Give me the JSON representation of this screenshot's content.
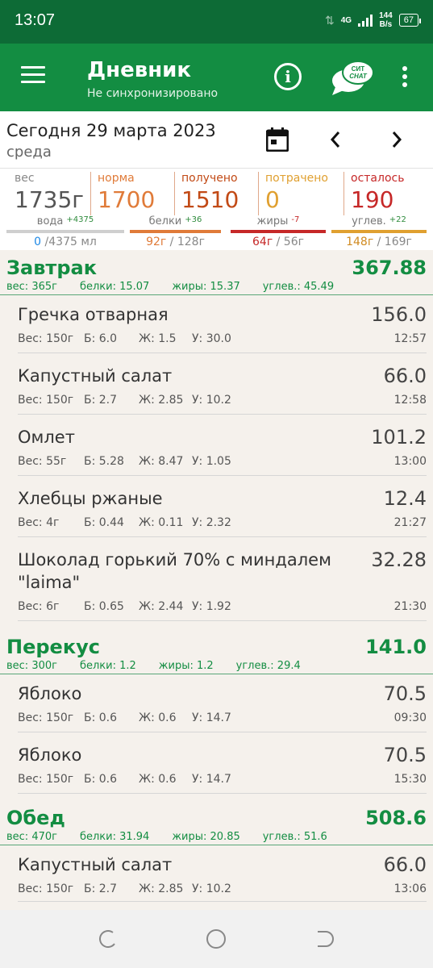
{
  "status": {
    "time": "13:07",
    "net": "4G",
    "speed_top": "144",
    "speed_bottom": "B/s",
    "battery": "67"
  },
  "header": {
    "title": "Дневник",
    "subtitle": "Не синхронизировано",
    "chat_badge_top": "СИТ",
    "chat_badge_bottom": "CHAT"
  },
  "date": {
    "label": "Сегодня 29 марта 2023",
    "weekday": "среда"
  },
  "summary": {
    "weight": {
      "label": "вес",
      "value": "1735г"
    },
    "norm": {
      "label": "норма",
      "value": "1700"
    },
    "received": {
      "label": "получено",
      "value": "1510"
    },
    "spent": {
      "label": "потрачено",
      "value": "0"
    },
    "left": {
      "label": "осталось",
      "value": "190"
    },
    "water": {
      "label": "вода",
      "delta": "+4375",
      "value": "0",
      "max": "/4375 мл"
    },
    "protein": {
      "label": "белки",
      "delta": "+36",
      "value": "92г",
      "max": " / 128г"
    },
    "fat": {
      "label": "жиры",
      "delta": "-7",
      "value": "64г",
      "max": " / 56г"
    },
    "carbs": {
      "label": "углев.",
      "delta": "+22",
      "value": "148г",
      "max": " / 169г"
    }
  },
  "colors": {
    "green": "#138d42",
    "orange": "#e07b39",
    "red": "#c62828",
    "gold": "#e0a030"
  },
  "sections": [
    {
      "name": "Завтрак",
      "total": "367.88",
      "macros": [
        "вес: 365г",
        "белки: 15.07",
        "жиры: 15.37",
        "углев.: 45.49"
      ],
      "items": [
        {
          "name": "Гречка отварная",
          "kcal": "156.0",
          "w": "Вес: 150г",
          "b": "Б: 6.0",
          "z": "Ж: 1.5",
          "u": "У: 30.0",
          "time": "12:57"
        },
        {
          "name": "Капустный салат",
          "kcal": "66.0",
          "w": "Вес: 150г",
          "b": "Б: 2.7",
          "z": "Ж: 2.85",
          "u": "У: 10.2",
          "time": "12:58"
        },
        {
          "name": "Омлет",
          "kcal": "101.2",
          "w": "Вес: 55г",
          "b": "Б: 5.28",
          "z": "Ж: 8.47",
          "u": "У: 1.05",
          "time": "13:00"
        },
        {
          "name": "Хлебцы ржаные",
          "kcal": "12.4",
          "w": "Вес: 4г",
          "b": "Б: 0.44",
          "z": "Ж: 0.11",
          "u": "У: 2.32",
          "time": "21:27"
        },
        {
          "name": "Шоколад горький 70% с миндалем \"laima\"",
          "kcal": "32.28",
          "w": "Вес: 6г",
          "b": "Б: 0.65",
          "z": "Ж: 2.44",
          "u": "У: 1.92",
          "time": "21:30"
        }
      ]
    },
    {
      "name": "Перекус",
      "total": "141.0",
      "macros": [
        "вес: 300г",
        "белки: 1.2",
        "жиры: 1.2",
        "углев.: 29.4"
      ],
      "items": [
        {
          "name": "Яблоко",
          "kcal": "70.5",
          "w": "Вес: 150г",
          "b": "Б: 0.6",
          "z": "Ж: 0.6",
          "u": "У: 14.7",
          "time": "09:30"
        },
        {
          "name": "Яблоко",
          "kcal": "70.5",
          "w": "Вес: 150г",
          "b": "Б: 0.6",
          "z": "Ж: 0.6",
          "u": "У: 14.7",
          "time": "15:30"
        }
      ]
    },
    {
      "name": "Обед",
      "total": "508.6",
      "macros": [
        "вес: 470г",
        "белки: 31.94",
        "жиры: 20.85",
        "углев.: 51.6"
      ],
      "items": [
        {
          "name": "Капустный салат",
          "kcal": "66.0",
          "w": "Вес: 150г",
          "b": "Б: 2.7",
          "z": "Ж: 2.85",
          "u": "У: 10.2",
          "time": "13:06"
        }
      ]
    }
  ]
}
